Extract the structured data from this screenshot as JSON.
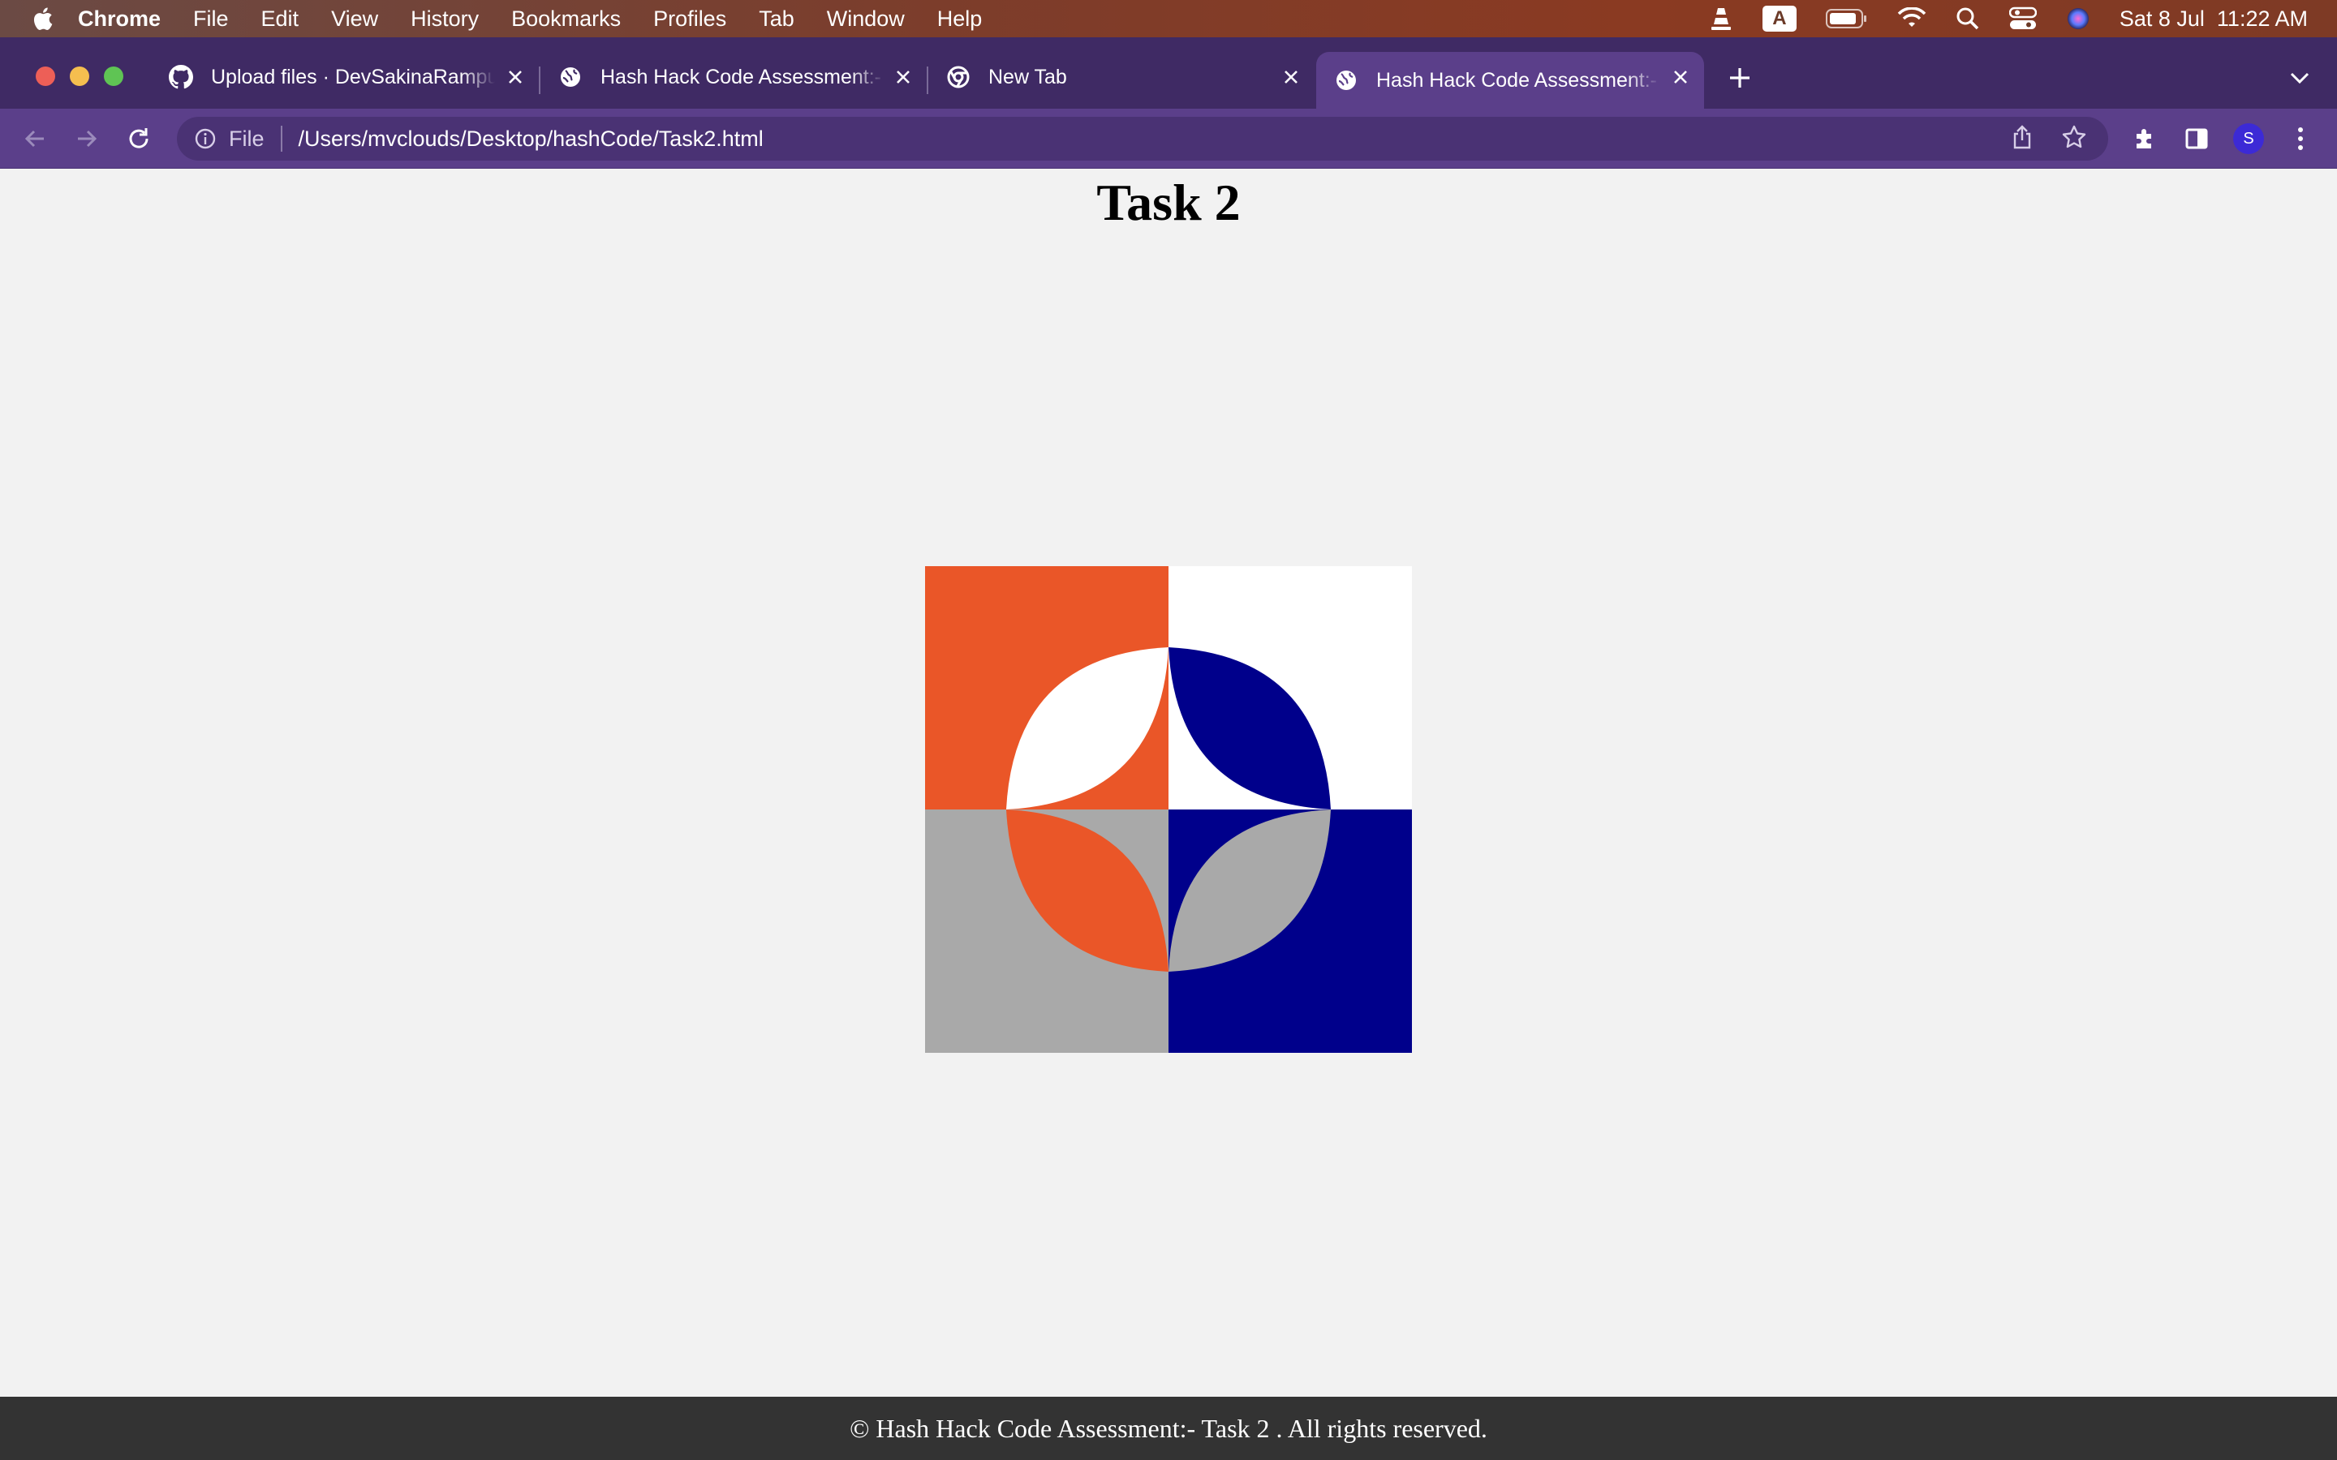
{
  "menubar": {
    "app_name": "Chrome",
    "items": [
      "File",
      "Edit",
      "View",
      "History",
      "Bookmarks",
      "Profiles",
      "Tab",
      "Window",
      "Help"
    ],
    "input_indicator": "A",
    "clock": "Sat 8 Jul  11:22 AM"
  },
  "tabs": [
    {
      "title": "Upload files · DevSakinaRampu",
      "icon": "github-icon",
      "active": false
    },
    {
      "title": "Hash Hack Code Assessment:-",
      "icon": "globe-icon",
      "active": false
    },
    {
      "title": "New Tab",
      "icon": "chrome-icon",
      "active": false
    },
    {
      "title": "Hash Hack Code Assessment:-",
      "icon": "globe-icon",
      "active": true
    }
  ],
  "omnibox": {
    "scheme": "File",
    "url": "/Users/mvclouds/Desktop/hashCode/Task2.html"
  },
  "profile": {
    "initial": "S"
  },
  "page": {
    "title": "Task 2",
    "footer": "© Hash Hack Code Assessment:- Task 2 . All rights reserved."
  },
  "art_colors": {
    "orange": "#ea5628",
    "white": "#ffffff",
    "navy": "#00008b",
    "gray": "#a9a9a9"
  }
}
